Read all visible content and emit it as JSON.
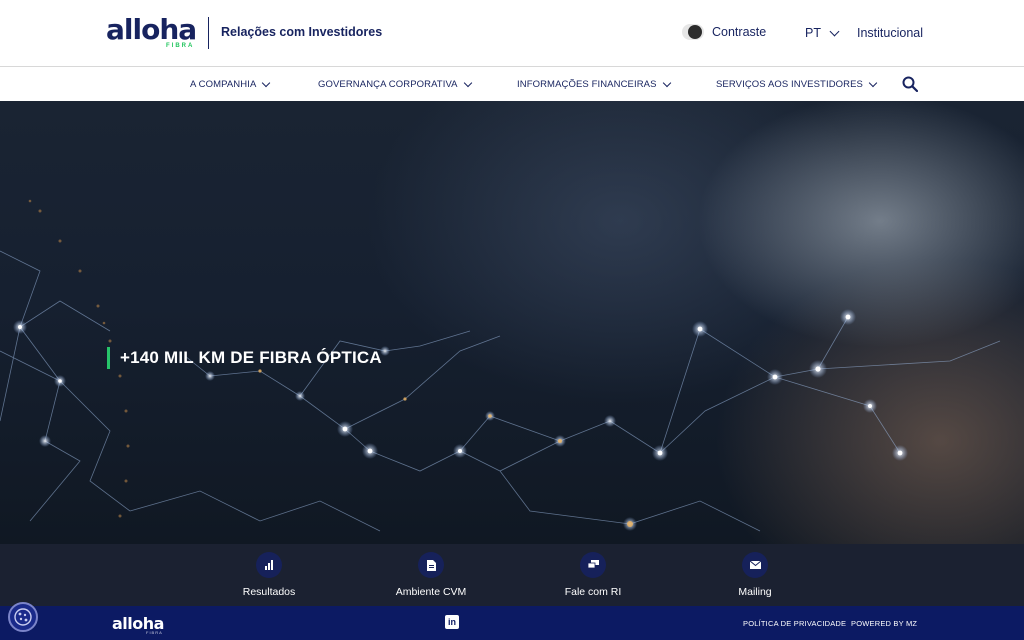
{
  "header": {
    "logo_text": "alloha",
    "logo_sub": "FIBRA",
    "site_title": "Relações com Investidores",
    "contrast_label": "Contraste",
    "language": "PT",
    "institucional_label": "Institucional"
  },
  "nav": {
    "items": [
      {
        "label": "A COMPANHIA"
      },
      {
        "label": "GOVERNANÇA CORPORATIVA"
      },
      {
        "label": "INFORMAÇÕES FINANCEIRAS"
      },
      {
        "label": "SERVIÇOS AOS INVESTIDORES"
      }
    ],
    "search_icon": "search-icon"
  },
  "hero": {
    "headline": "+140 MIL KM DE FIBRA ÓPTICA"
  },
  "quick_links": [
    {
      "label": "Resultados",
      "icon": "bar-chart-icon"
    },
    {
      "label": "Ambiente CVM",
      "icon": "document-icon"
    },
    {
      "label": "Fale com RI",
      "icon": "chat-icon"
    },
    {
      "label": "Mailing",
      "icon": "envelope-icon"
    }
  ],
  "footer": {
    "logo_text": "alloha",
    "logo_sub": "FIBRA",
    "social_icon": "linkedin-icon",
    "privacy_label": "POLÍTICA DE PRIVACIDADE",
    "powered_label": "POWERED BY MZ"
  },
  "colors": {
    "brand_navy": "#17235f",
    "accent_green": "#27c46a",
    "footer_bg": "#0c1a63",
    "quickbar_bg": "#080e20"
  },
  "cookie_icon": "cookie-settings-icon"
}
